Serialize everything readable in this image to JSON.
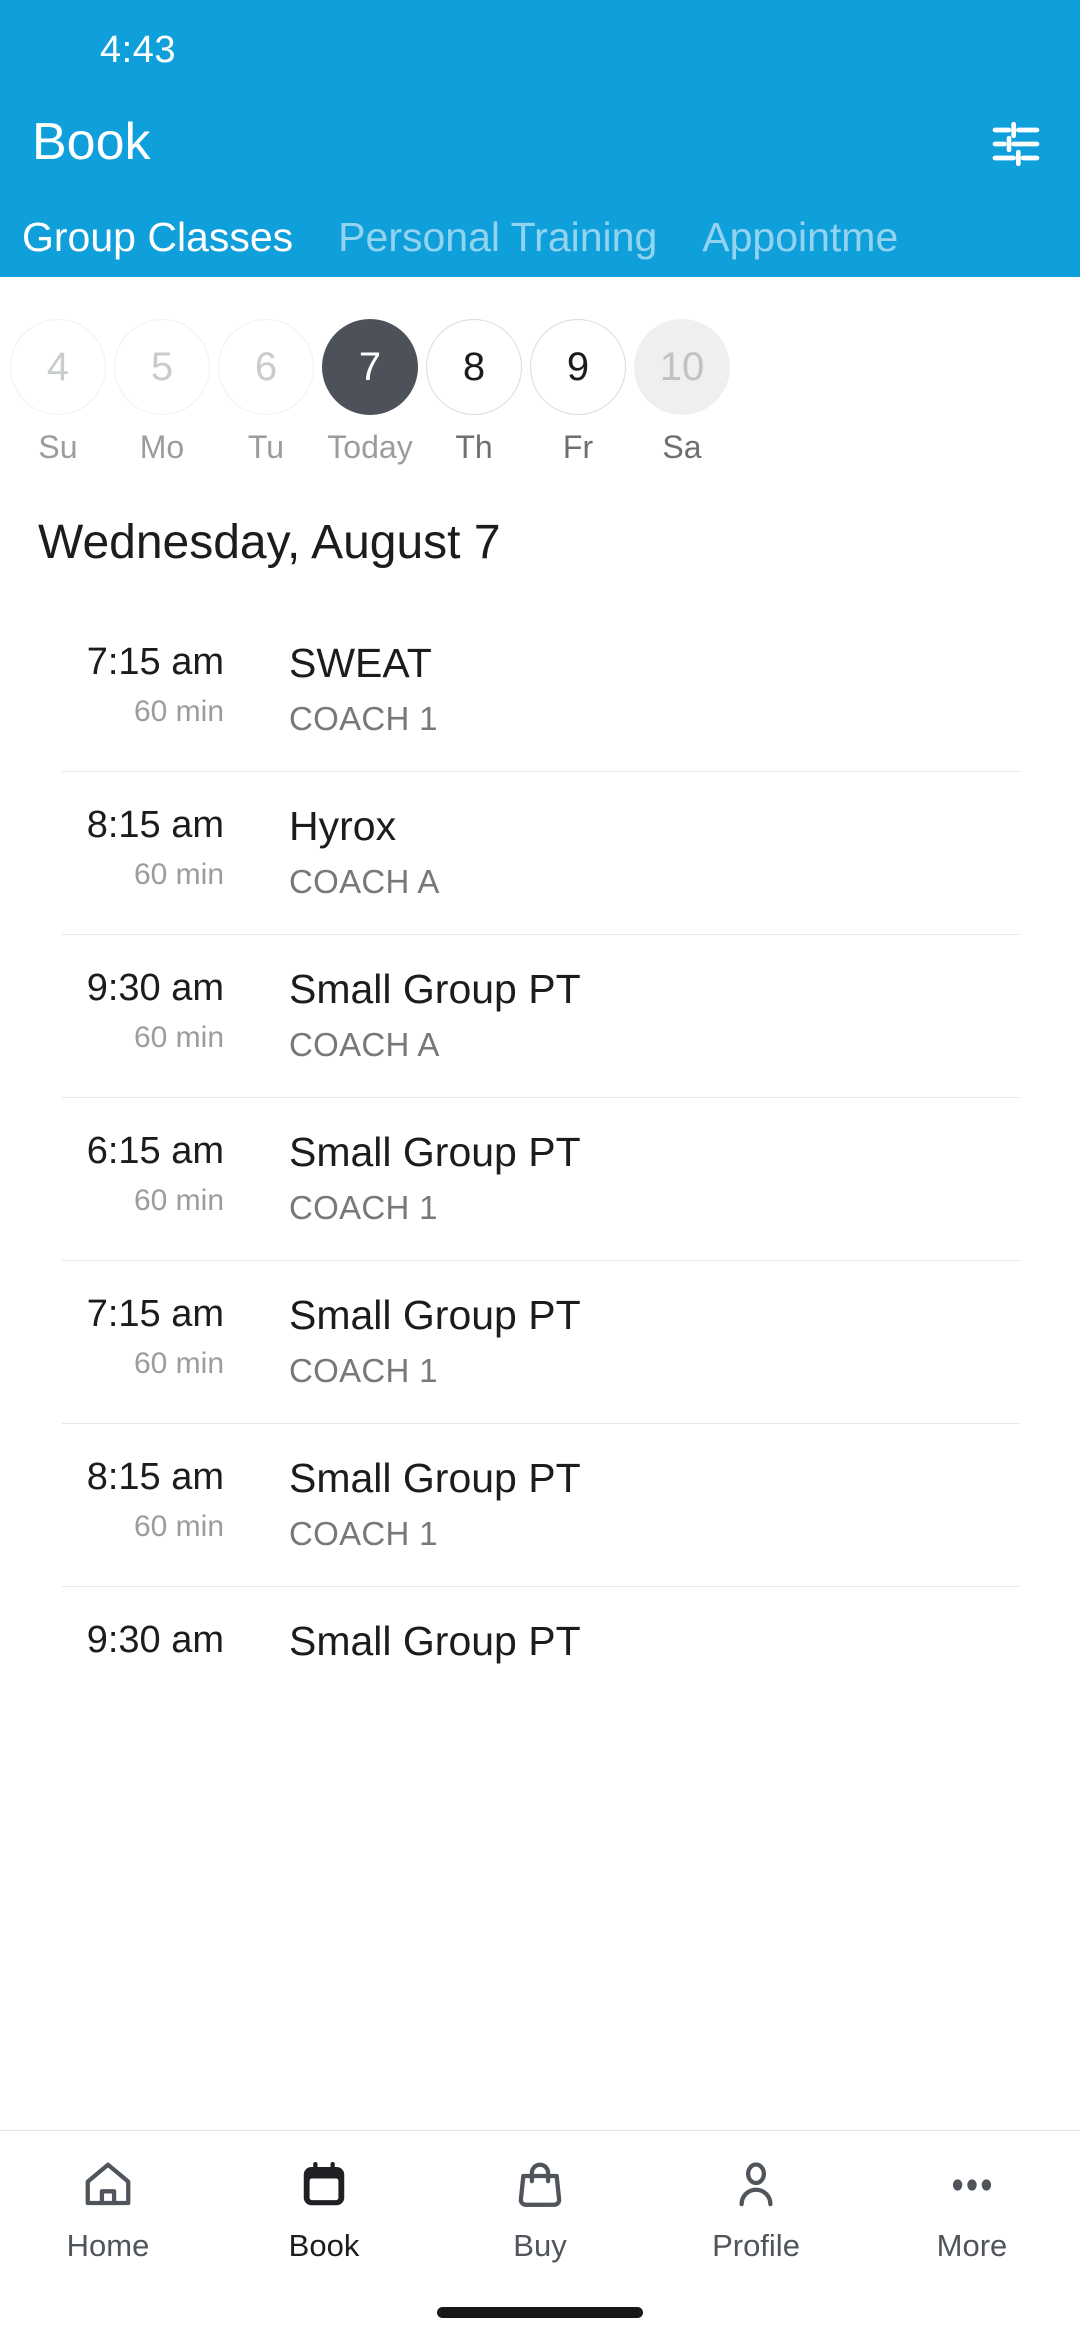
{
  "status_bar": {
    "time": "4:43"
  },
  "app_bar": {
    "title": "Book",
    "filter_icon": "tune-filter-icon"
  },
  "tabs": [
    {
      "label": "Group Classes",
      "active": true
    },
    {
      "label": "Personal Training",
      "active": false
    },
    {
      "label": "Appointme",
      "active": false
    }
  ],
  "date_strip": [
    {
      "day": "4",
      "label": "Su",
      "state": "past"
    },
    {
      "day": "5",
      "label": "Mo",
      "state": "past"
    },
    {
      "day": "6",
      "label": "Tu",
      "state": "past"
    },
    {
      "day": "7",
      "label": "Today",
      "state": "today"
    },
    {
      "day": "8",
      "label": "Th",
      "state": "future"
    },
    {
      "day": "9",
      "label": "Fr",
      "state": "future"
    },
    {
      "day": "10",
      "label": "Sa",
      "state": "dim"
    }
  ],
  "schedule": {
    "heading": "Wednesday, August 7",
    "classes": [
      {
        "time": "7:15 am",
        "duration": "60 min",
        "name": "SWEAT",
        "coach": "COACH 1"
      },
      {
        "time": "8:15 am",
        "duration": "60 min",
        "name": "Hyrox",
        "coach": "COACH A"
      },
      {
        "time": "9:30 am",
        "duration": "60 min",
        "name": "Small Group PT",
        "coach": "COACH A"
      },
      {
        "time": "6:15 am",
        "duration": "60 min",
        "name": "Small Group PT",
        "coach": "COACH 1"
      },
      {
        "time": "7:15 am",
        "duration": "60 min",
        "name": "Small Group PT",
        "coach": "COACH 1"
      },
      {
        "time": "8:15 am",
        "duration": "60 min",
        "name": "Small Group PT",
        "coach": "COACH 1"
      },
      {
        "time": "9:30 am",
        "duration": "",
        "name": "Small Group PT",
        "coach": ""
      }
    ]
  },
  "bottom_nav": [
    {
      "label": "Home",
      "icon": "home-icon",
      "active": false
    },
    {
      "label": "Book",
      "icon": "calendar-icon",
      "active": true
    },
    {
      "label": "Buy",
      "icon": "bag-icon",
      "active": false
    },
    {
      "label": "Profile",
      "icon": "person-icon",
      "active": false
    },
    {
      "label": "More",
      "icon": "dots-icon",
      "active": false
    }
  ],
  "colors": {
    "brand_blue": "#0f9fdb",
    "today_circle": "#4d525a",
    "text_primary": "#1c1c1c",
    "text_muted": "#9a9da0"
  }
}
